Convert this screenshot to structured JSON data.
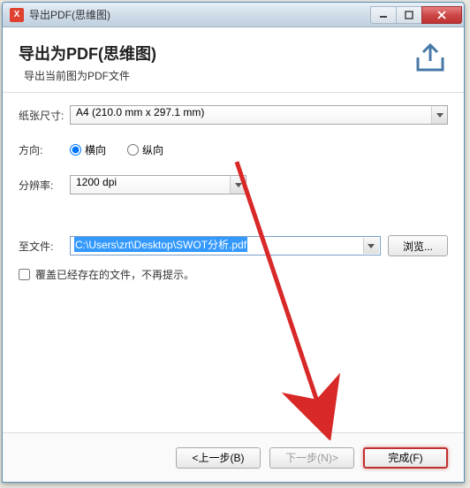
{
  "titlebar": {
    "icon_letter": "X",
    "title": "导出PDF(思维图)"
  },
  "header": {
    "title": "导出为PDF(思维图)",
    "subtitle": "导出当前图为PDF文件"
  },
  "form": {
    "paper_label": "纸张尺寸:",
    "paper_value": "A4 (210.0 mm x 297.1 mm)",
    "orientation_label": "方向:",
    "orientation_h": "横向",
    "orientation_v": "纵向",
    "orientation_selected": "horizontal",
    "dpi_label": "分辨率:",
    "dpi_value": "1200 dpi",
    "tofile_label": "至文件:",
    "tofile_value": "C:\\Users\\zrt\\Desktop\\SWOT分析.pdf",
    "browse_label": "浏览...",
    "overwrite_label": "覆盖已经存在的文件，不再提示。"
  },
  "footer": {
    "back": "<上一步(B)",
    "next": "下一步(N)>",
    "finish": "完成(F)"
  }
}
